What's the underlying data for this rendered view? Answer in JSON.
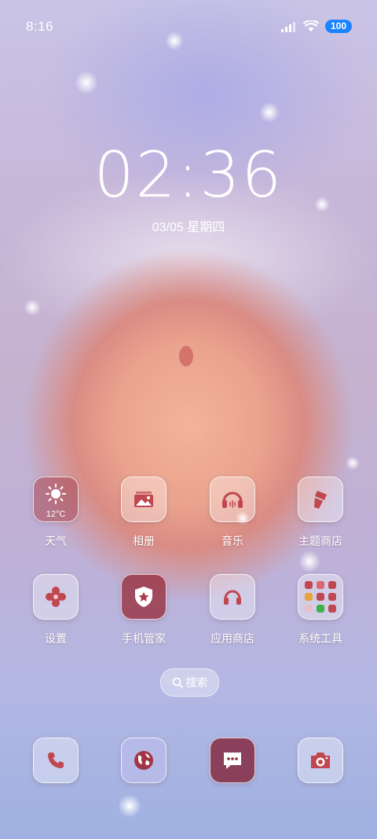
{
  "status_bar": {
    "time": "8:16",
    "battery": "100"
  },
  "lockscreen": {
    "clock": "02:36",
    "date": "03/05 星期四"
  },
  "weather": {
    "temp": "12°C"
  },
  "apps_row1": [
    {
      "label": "天气",
      "icon": "weather-sun-icon"
    },
    {
      "label": "相册",
      "icon": "gallery-icon"
    },
    {
      "label": "音乐",
      "icon": "music-icon"
    },
    {
      "label": "主题商店",
      "icon": "theme-store-icon"
    }
  ],
  "apps_row2": [
    {
      "label": "设置",
      "icon": "gear-icon"
    },
    {
      "label": "手机管家",
      "icon": "phone-manager-shield-icon"
    },
    {
      "label": "应用商店",
      "icon": "app-store-icon"
    },
    {
      "label": "系统工具",
      "icon": "folder-icon"
    }
  ],
  "search": {
    "label": "搜索"
  },
  "dock": [
    {
      "icon": "phone-icon"
    },
    {
      "icon": "browser-globe-icon"
    },
    {
      "icon": "messages-icon"
    },
    {
      "icon": "camera-icon"
    }
  ],
  "colors": {
    "accent_battery": "#1c83ff",
    "icon_red": "#c0474f"
  }
}
